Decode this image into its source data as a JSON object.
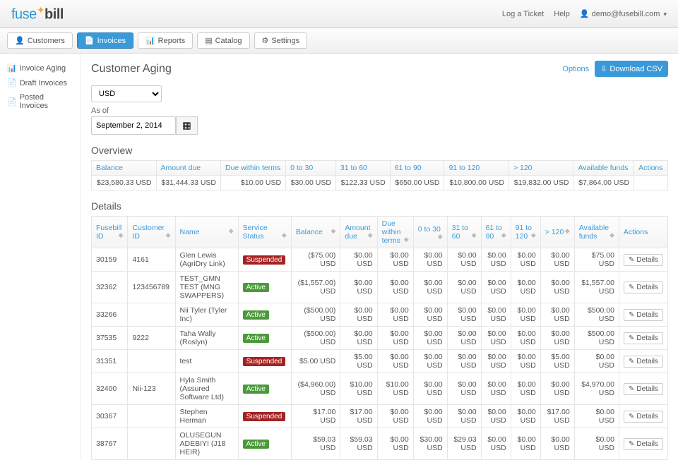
{
  "topbar": {
    "logo_prefix": "fuse",
    "logo_suffix": "bill",
    "links": {
      "log_ticket": "Log a Ticket",
      "help": "Help",
      "user": "demo@fusebill.com"
    }
  },
  "nav": {
    "customers": "Customers",
    "invoices": "Invoices",
    "reports": "Reports",
    "catalog": "Catalog",
    "settings": "Settings"
  },
  "sidebar": {
    "invoice_aging": "Invoice Aging",
    "draft_invoices": "Draft Invoices",
    "posted_invoices": "Posted Invoices"
  },
  "page": {
    "title": "Customer Aging",
    "options": "Options",
    "download": "Download CSV",
    "currency_value": "USD",
    "asof_label": "As of",
    "asof_value": "September 2, 2014"
  },
  "overview": {
    "heading": "Overview",
    "headers": {
      "balance": "Balance",
      "amount_due": "Amount due",
      "due_within": "Due within terms",
      "r0_30": "0 to 30",
      "r31_60": "31 to 60",
      "r61_90": "61 to 90",
      "r91_120": "91 to 120",
      "r120p": "> 120",
      "avail": "Available funds",
      "actions": "Actions"
    },
    "row": {
      "balance": "$23,580.33 USD",
      "amount_due": "$31,444.33 USD",
      "due_within": "$10.00 USD",
      "r0_30": "$30.00 USD",
      "r31_60": "$122.33 USD",
      "r61_90": "$650.00 USD",
      "r91_120": "$10,800.00 USD",
      "r120p": "$19,832.00 USD",
      "avail": "$7,864.00 USD"
    }
  },
  "details": {
    "heading": "Details",
    "headers": {
      "fusebill_id": "Fusebill ID",
      "customer_id": "Customer ID",
      "name": "Name",
      "status": "Service Status",
      "balance": "Balance",
      "amount_due": "Amount due",
      "due_within": "Due within terms",
      "r0_30": "0 to 30",
      "r31_60": "31 to 60",
      "r61_90": "61 to 90",
      "r91_120": "91 to 120",
      "r120p": "> 120",
      "avail": "Available funds",
      "actions": "Actions"
    },
    "status_labels": {
      "suspended": "Suspended",
      "active": "Active"
    },
    "details_btn": "Details",
    "rows": [
      {
        "fid": "30159",
        "cid": "4161",
        "name": "Glen Lewis (AgriDry Link)",
        "status": "suspended",
        "balance": "($75.00) USD",
        "amount_due": "$0.00 USD",
        "due_within": "$0.00 USD",
        "r0_30": "$0.00 USD",
        "r31_60": "$0.00 USD",
        "r61_90": "$0.00 USD",
        "r91_120": "$0.00 USD",
        "r120p": "$0.00 USD",
        "avail": "$75.00 USD"
      },
      {
        "fid": "32362",
        "cid": "123456789",
        "name": "TEST_GMN TEST (MNG SWAPPERS)",
        "status": "active",
        "balance": "($1,557.00) USD",
        "amount_due": "$0.00 USD",
        "due_within": "$0.00 USD",
        "r0_30": "$0.00 USD",
        "r31_60": "$0.00 USD",
        "r61_90": "$0.00 USD",
        "r91_120": "$0.00 USD",
        "r120p": "$0.00 USD",
        "avail": "$1,557.00 USD"
      },
      {
        "fid": "33266",
        "cid": "",
        "name": "Nii Tyler (Tyler Inc)",
        "status": "active",
        "balance": "($500.00) USD",
        "amount_due": "$0.00 USD",
        "due_within": "$0.00 USD",
        "r0_30": "$0.00 USD",
        "r31_60": "$0.00 USD",
        "r61_90": "$0.00 USD",
        "r91_120": "$0.00 USD",
        "r120p": "$0.00 USD",
        "avail": "$500.00 USD"
      },
      {
        "fid": "37535",
        "cid": "9222",
        "name": "Taha Wally (Roslyn)",
        "status": "active",
        "balance": "($500.00) USD",
        "amount_due": "$0.00 USD",
        "due_within": "$0.00 USD",
        "r0_30": "$0.00 USD",
        "r31_60": "$0.00 USD",
        "r61_90": "$0.00 USD",
        "r91_120": "$0.00 USD",
        "r120p": "$0.00 USD",
        "avail": "$500.00 USD"
      },
      {
        "fid": "31351",
        "cid": "",
        "name": "test",
        "status": "suspended",
        "balance": "$5.00 USD",
        "amount_due": "$5.00 USD",
        "due_within": "$0.00 USD",
        "r0_30": "$0.00 USD",
        "r31_60": "$0.00 USD",
        "r61_90": "$0.00 USD",
        "r91_120": "$0.00 USD",
        "r120p": "$5.00 USD",
        "avail": "$0.00 USD"
      },
      {
        "fid": "32400",
        "cid": "Nii-123",
        "name": "Hyla Smith (Assured Software Ltd)",
        "status": "active",
        "balance": "($4,960.00) USD",
        "amount_due": "$10.00 USD",
        "due_within": "$10.00 USD",
        "r0_30": "$0.00 USD",
        "r31_60": "$0.00 USD",
        "r61_90": "$0.00 USD",
        "r91_120": "$0.00 USD",
        "r120p": "$0.00 USD",
        "avail": "$4,970.00 USD"
      },
      {
        "fid": "30367",
        "cid": "",
        "name": "Stephen Herman",
        "status": "suspended",
        "balance": "$17.00 USD",
        "amount_due": "$17.00 USD",
        "due_within": "$0.00 USD",
        "r0_30": "$0.00 USD",
        "r31_60": "$0.00 USD",
        "r61_90": "$0.00 USD",
        "r91_120": "$0.00 USD",
        "r120p": "$17.00 USD",
        "avail": "$0.00 USD"
      },
      {
        "fid": "38767",
        "cid": "",
        "name": "OLUSEGUN ADEBIYI (J18 HEIR)",
        "status": "active",
        "balance": "$59.03 USD",
        "amount_due": "$59.03 USD",
        "due_within": "$0.00 USD",
        "r0_30": "$30.00 USD",
        "r31_60": "$29.03 USD",
        "r61_90": "$0.00 USD",
        "r91_120": "$0.00 USD",
        "r120p": "$0.00 USD",
        "avail": "$0.00 USD"
      }
    ]
  }
}
